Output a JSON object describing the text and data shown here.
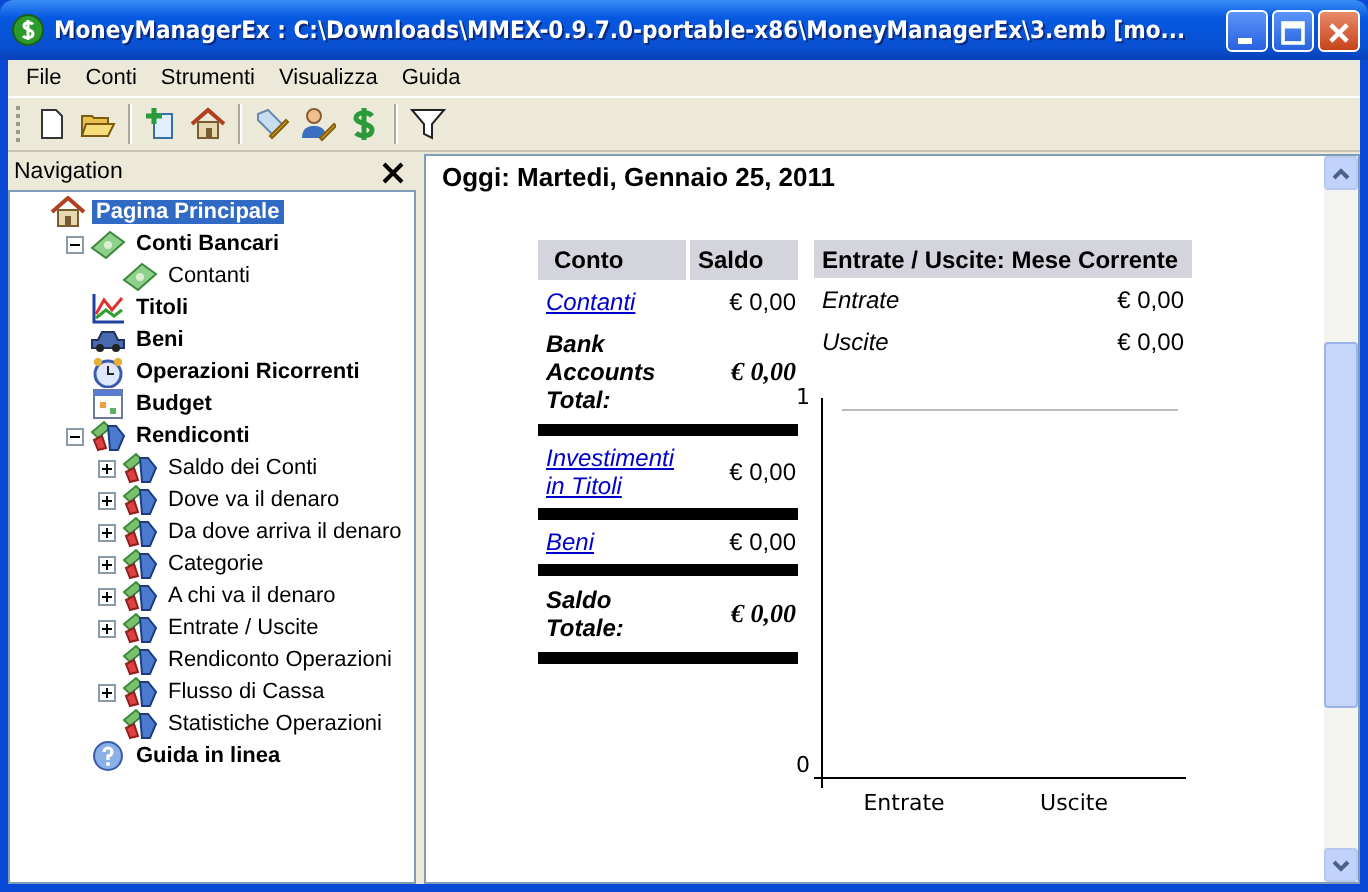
{
  "window": {
    "title": "MoneyManagerEx : C:\\Downloads\\MMEX-0.9.7.0-portable-x86\\MoneyManagerEx\\3.emb [mo..."
  },
  "menu": [
    "File",
    "Conti",
    "Strumenti",
    "Visualizza",
    "Guida"
  ],
  "toolbar": [
    {
      "kind": "new"
    },
    {
      "kind": "open"
    },
    {
      "kind": "sep"
    },
    {
      "kind": "add"
    },
    {
      "kind": "home"
    },
    {
      "kind": "sep"
    },
    {
      "kind": "tag"
    },
    {
      "kind": "user"
    },
    {
      "kind": "dollar"
    },
    {
      "kind": "sep"
    },
    {
      "kind": "filter"
    }
  ],
  "navigation": {
    "title": "Navigation",
    "tree": [
      {
        "label": "Pagina Principale",
        "kind": "home",
        "selected": true,
        "children": [
          {
            "label": "Conti Bancari",
            "kind": "money",
            "selected": false,
            "expanded": true,
            "children": [
              {
                "label": "Contanti",
                "kind": "money",
                "selected": false
              }
            ]
          },
          {
            "label": "Titoli",
            "kind": "chart",
            "selected": false
          },
          {
            "label": "Beni",
            "kind": "car",
            "selected": false
          },
          {
            "label": "Operazioni Ricorrenti",
            "kind": "clock",
            "selected": false
          },
          {
            "label": "Budget",
            "kind": "calendar",
            "selected": false
          },
          {
            "label": "Rendiconti",
            "kind": "report",
            "selected": false,
            "expanded": true,
            "children": [
              {
                "label": "Saldo dei Conti",
                "kind": "report",
                "selected": false,
                "expanded": false
              },
              {
                "label": "Dove va il denaro",
                "kind": "report",
                "selected": false,
                "expanded": false
              },
              {
                "label": "Da dove arriva il denaro",
                "kind": "report",
                "selected": false,
                "expanded": false
              },
              {
                "label": "Categorie",
                "kind": "report",
                "selected": false,
                "expanded": false
              },
              {
                "label": "A chi va il denaro",
                "kind": "report",
                "selected": false,
                "expanded": false
              },
              {
                "label": "Entrate / Uscite",
                "kind": "report",
                "selected": false,
                "expanded": false
              },
              {
                "label": "Rendiconto Operazioni",
                "kind": "report",
                "selected": false
              },
              {
                "label": "Flusso di Cassa",
                "kind": "report",
                "selected": false,
                "expanded": false
              },
              {
                "label": "Statistiche Operazioni",
                "kind": "report",
                "selected": false
              }
            ]
          },
          {
            "label": "Guida in linea",
            "kind": "help",
            "selected": false
          }
        ]
      }
    ]
  },
  "content": {
    "heading": "Oggi: Martedi, Gennaio 25, 2011",
    "accounts": {
      "columns": [
        "Conto",
        "Saldo"
      ],
      "rows": [
        {
          "kind": "link",
          "name": "Contanti",
          "balance": "€ 0,00"
        },
        {
          "kind": "total",
          "name": "Bank Accounts Total:",
          "balance": "€ 0,00"
        },
        {
          "kind": "rule"
        },
        {
          "kind": "link",
          "name": "Investimenti in Titoli",
          "balance": "€ 0,00"
        },
        {
          "kind": "rule"
        },
        {
          "kind": "link",
          "name": "Beni",
          "balance": "€ 0,00"
        },
        {
          "kind": "rule"
        },
        {
          "kind": "total",
          "name": "Saldo Totale:",
          "balance": "€ 0,00"
        },
        {
          "kind": "rule"
        }
      ]
    },
    "income": {
      "title": "Entrate / Uscite: Mese Corrente",
      "rows": [
        {
          "label": "Entrate",
          "value": "€ 0,00"
        },
        {
          "label": "Uscite",
          "value": "€ 0,00"
        }
      ],
      "chart_data": {
        "type": "bar",
        "categories": [
          "Entrate",
          "Uscite"
        ],
        "values": [
          0,
          0
        ],
        "ylim": [
          0,
          1
        ],
        "yticks": [
          0,
          1
        ]
      }
    }
  }
}
